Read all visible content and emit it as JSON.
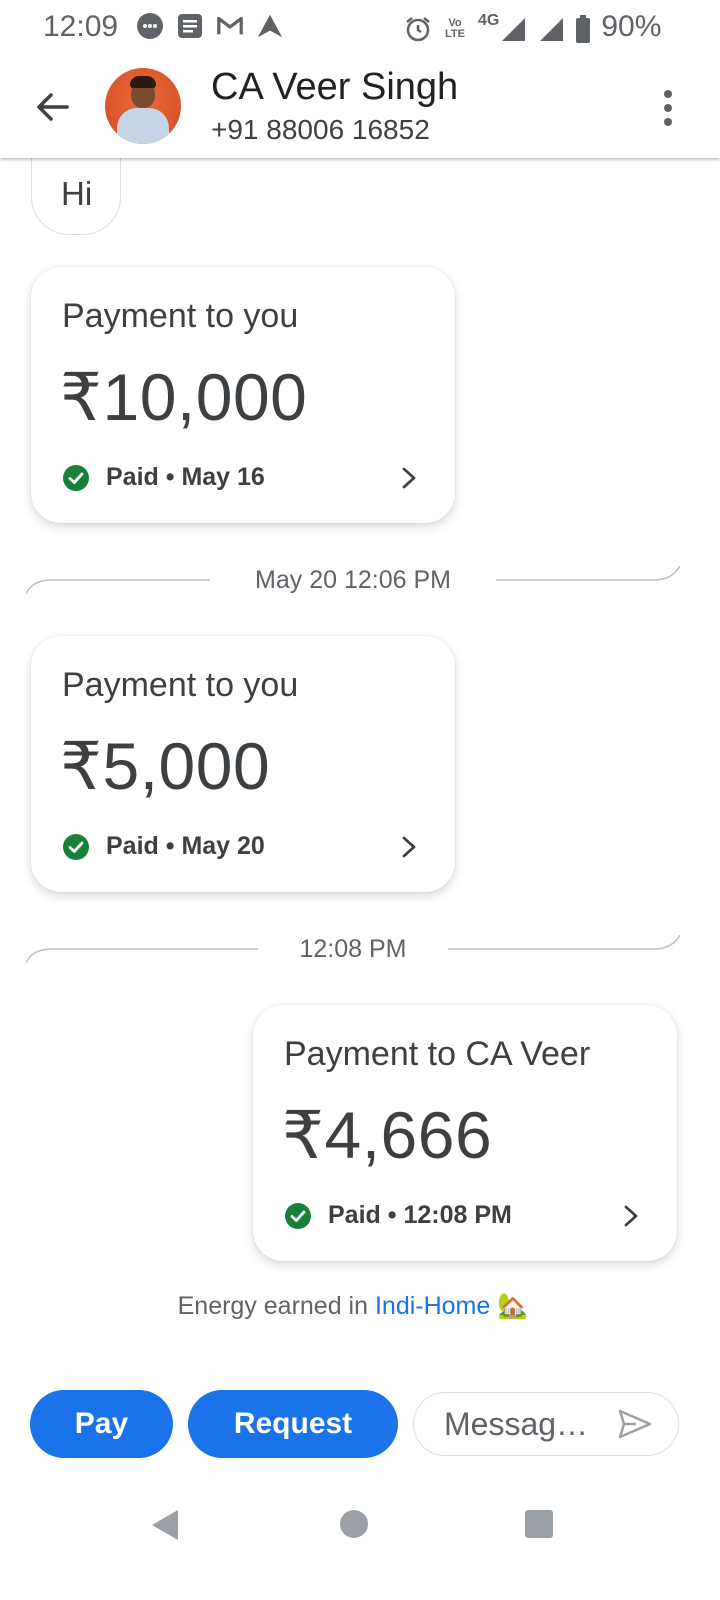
{
  "status_bar": {
    "time": "12:09",
    "network": "4G",
    "volte": "Vo LTE",
    "battery": "90%",
    "icons": [
      "chat-bubble-icon",
      "message-icon",
      "gmail-icon",
      "navigation-icon",
      "alarm-icon",
      "signal-icon",
      "signal-icon",
      "battery-icon"
    ]
  },
  "header": {
    "name": "CA Veer Singh",
    "phone": "+91 88006 16852",
    "back_icon": "arrow-left-icon",
    "menu_icon": "more-vert-icon"
  },
  "messages": {
    "hi_text": "Hi",
    "payment1": {
      "title": "Payment to you",
      "amount": "₹10,000",
      "status": "Paid • May 16"
    },
    "divider1": "May 20 12:06 PM",
    "payment2": {
      "title": "Payment to you",
      "amount": "₹5,000",
      "status": "Paid • May 20"
    },
    "divider2": "12:08 PM",
    "payment3": {
      "title": "Payment to CA Veer",
      "amount": "₹4,666",
      "status": "Paid • 12:08 PM"
    }
  },
  "energy": {
    "prefix": "Energy earned in",
    "link": "Indi-Home",
    "emoji": "🏡"
  },
  "actions": {
    "pay": "Pay",
    "request": "Request",
    "message_placeholder": "Messag…"
  },
  "colors": {
    "accent": "#1a73e8",
    "paid_green": "#188038",
    "text": "#3c4043",
    "muted": "#5f6368"
  }
}
